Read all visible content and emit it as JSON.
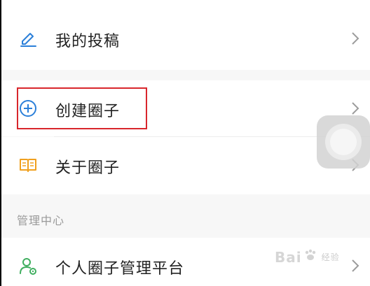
{
  "menu": {
    "my_posts": {
      "label": "我的投稿",
      "icon": "pencil-icon"
    },
    "create_circle": {
      "label": "创建圈子",
      "icon": "plus-circle-icon"
    },
    "about_circle": {
      "label": "关于圈子",
      "icon": "book-icon"
    }
  },
  "management": {
    "section_title": "管理中心",
    "personal_platform": {
      "label": "个人圈子管理平台",
      "icon": "person-gear-icon"
    }
  },
  "watermark": {
    "text_left": "Bai",
    "text_right": "经验"
  },
  "colors": {
    "accent_blue": "#2b7fd9",
    "book_orange": "#f0a01e",
    "admin_green": "#3fae5f",
    "highlight_red": "#d8262c"
  }
}
